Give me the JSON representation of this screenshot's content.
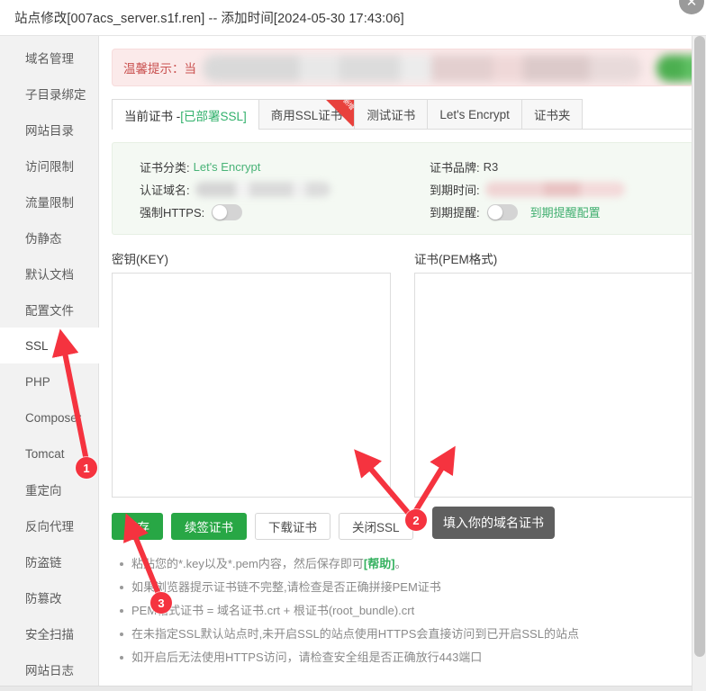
{
  "window": {
    "title": "站点修改[007acs_server.s1f.ren] -- 添加时间[2024-05-30 17:43:06]",
    "close_icon": "✕"
  },
  "sidebar": {
    "items": [
      {
        "label": "域名管理",
        "active": false
      },
      {
        "label": "子目录绑定",
        "active": false
      },
      {
        "label": "网站目录",
        "active": false
      },
      {
        "label": "访问限制",
        "active": false
      },
      {
        "label": "流量限制",
        "active": false
      },
      {
        "label": "伪静态",
        "active": false
      },
      {
        "label": "默认文档",
        "active": false
      },
      {
        "label": "配置文件",
        "active": false
      },
      {
        "label": "SSL",
        "active": true
      },
      {
        "label": "PHP",
        "active": false
      },
      {
        "label": "Composer",
        "active": false
      },
      {
        "label": "Tomcat",
        "active": false
      },
      {
        "label": "重定向",
        "active": false
      },
      {
        "label": "反向代理",
        "active": false
      },
      {
        "label": "防盗链",
        "active": false
      },
      {
        "label": "防篡改",
        "active": false
      },
      {
        "label": "安全扫描",
        "active": false
      },
      {
        "label": "网站日志",
        "active": false
      }
    ]
  },
  "alert": {
    "label": "温馨提示：",
    "text_visible": "当",
    "redacted": true
  },
  "tabs": [
    {
      "label_prefix": "当前证书 - ",
      "label_status": "[已部署SSL]",
      "active": true,
      "badge": ""
    },
    {
      "label_prefix": "商用SSL证书",
      "label_status": "",
      "active": false,
      "badge": "新增"
    },
    {
      "label_prefix": "测试证书",
      "label_status": "",
      "active": false,
      "badge": ""
    },
    {
      "label_prefix": "Let's Encrypt",
      "label_status": "",
      "active": false,
      "badge": ""
    },
    {
      "label_prefix": "证书夹",
      "label_status": "",
      "active": false,
      "badge": ""
    }
  ],
  "cert_info": {
    "category_key": "证书分类:",
    "category_value": "Let's Encrypt",
    "brand_key": "证书品牌:",
    "brand_value": "R3",
    "domain_key": "认证域名:",
    "domain_value_redacted": true,
    "expire_key": "到期时间:",
    "expire_value_redacted": true,
    "force_https_key": "强制HTTPS:",
    "force_https_on": false,
    "expire_notice_key": "到期提醒:",
    "expire_notice_on": false,
    "expire_notice_link": "到期提醒配置"
  },
  "editors": {
    "key_label": "密钥(KEY)",
    "key_value": "",
    "key_placeholder": "",
    "pem_label": "证书(PEM格式)",
    "pem_value": "",
    "pem_placeholder": ""
  },
  "buttons": [
    {
      "label": "保存",
      "style": "green"
    },
    {
      "label": "续签证书",
      "style": "green"
    },
    {
      "label": "下载证书",
      "style": "default"
    },
    {
      "label": "关闭SSL",
      "style": "default"
    }
  ],
  "notes": [
    {
      "pre": "粘贴您的*.key以及*.pem内容，然后保存即可",
      "link": "[帮助]",
      "post": "。"
    },
    {
      "pre": "如果浏览器提示证书链不完整,请检查是否正确拼接PEM证书",
      "link": "",
      "post": ""
    },
    {
      "pre": "PEM格式证书 = 域名证书.crt + 根证书(root_bundle).crt",
      "link": "",
      "post": ""
    },
    {
      "pre": "在未指定SSL默认站点时,未开启SSL的站点使用HTTPS会直接访问到已开启SSL的站点",
      "link": "",
      "post": ""
    },
    {
      "pre": "如开启后无法使用HTTPS访问，请检查安全组是否正确放行443端口",
      "link": "",
      "post": ""
    }
  ],
  "annotations": {
    "marker1": "1",
    "marker2": "2",
    "marker3": "3",
    "tooltip2": "填入你的域名证书",
    "arrow_color": "#f5333f"
  }
}
